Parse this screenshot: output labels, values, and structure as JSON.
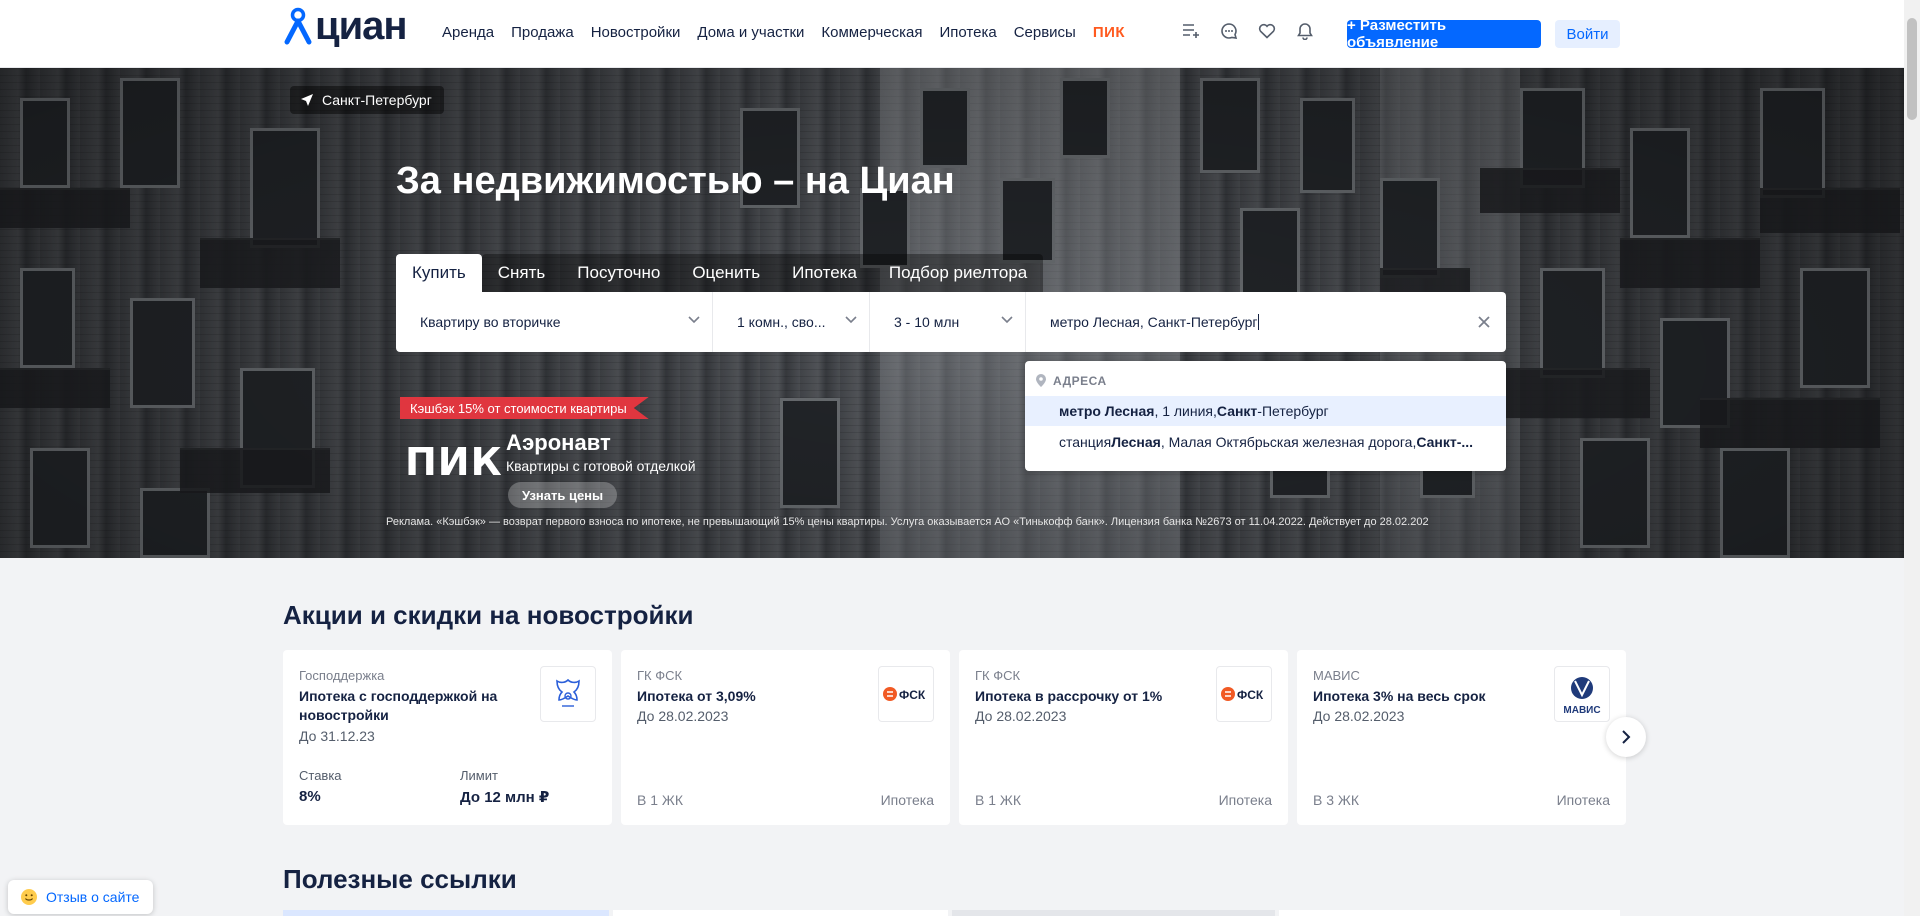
{
  "header": {
    "logo_text": "циан",
    "nav": [
      "Аренда",
      "Продажа",
      "Новостройки",
      "Дома и участки",
      "Коммерческая",
      "Ипотека",
      "Сервисы"
    ],
    "nav_pik": "ПИК",
    "icons": [
      "compare-list-icon",
      "chat-icon",
      "heart-icon",
      "bell-icon"
    ],
    "post_button": "+ Разместить объявление",
    "login_button": "Войти"
  },
  "hero": {
    "city": "Санкт-Петербург",
    "title": "За недвижимостью – на Циан",
    "tabs": [
      "Купить",
      "Снять",
      "Посуточно",
      "Оценить",
      "Ипотека",
      "Подбор риелтора"
    ],
    "active_tab": "Купить",
    "search": {
      "type": "Квартиру во вторичке",
      "rooms": "1 комн., сво...",
      "price": "3 - 10 млн",
      "location": "метро Лесная, Санкт-Петербург"
    },
    "suggest": {
      "header": "АДРЕСА",
      "items": [
        {
          "b1": "метро Лесная",
          "t1": ", 1 линия, ",
          "b2": "Санкт",
          "t2": "-Петербург"
        },
        {
          "t0": "станция ",
          "b1": "Лесная",
          "t1": ", Малая Октябрьская железная дорога, ",
          "b2": "Санкт-...",
          "t2": ""
        }
      ]
    },
    "promo": {
      "ribbon": "Кэшбэк 15% от стоимости квартиры",
      "brand": "ПИК",
      "title": "Аэронавт",
      "subtitle": "Квартиры с готовой отделкой",
      "button": "Узнать цены",
      "legal": "Реклама. «Кэшбэк» — возврат первого взноса по ипотеке, не превышающий 15% цены квартиры. Услуга оказывается АО «Тинькофф банк». Лицензия банка №2673 от 11.04.2022. Действует до 28.02.202"
    }
  },
  "promotions": {
    "title": "Акции и скидки на новостройки",
    "cards": [
      {
        "category": "Господдержка",
        "name": "Ипотека с господдержкой на новостройки",
        "date": "До 31.12.23",
        "rate_label": "Ставка",
        "rate_value": "8%",
        "limit_label": "Лимит",
        "limit_value": "До 12 млн ₽",
        "logo": "gerb-icon"
      },
      {
        "category": "ГК ФСК",
        "name": "Ипотека от 3,09%",
        "date": "До 28.02.2023",
        "footer_left": "В 1 ЖК",
        "footer_right": "Ипотека",
        "logo_text": "ФСК"
      },
      {
        "category": "ГК ФСК",
        "name": "Ипотека в рассрочку от 1%",
        "date": "До 28.02.2023",
        "footer_left": "В 1 ЖК",
        "footer_right": "Ипотека",
        "logo_text": "ФСК"
      },
      {
        "category": "МАВИС",
        "name": "Ипотека 3% на весь срок",
        "date": "До 28.02.2023",
        "footer_left": "В 3 ЖК",
        "footer_right": "Ипотека",
        "logo_text": "МАВИС"
      }
    ]
  },
  "links": {
    "title": "Полезные ссылки"
  },
  "feedback": "Отзыв о сайте",
  "colors": {
    "brand_blue": "#0468ff",
    "text_dark": "#152242",
    "pik_orange": "#ff5a1f",
    "promo_red": "#e0363f"
  }
}
